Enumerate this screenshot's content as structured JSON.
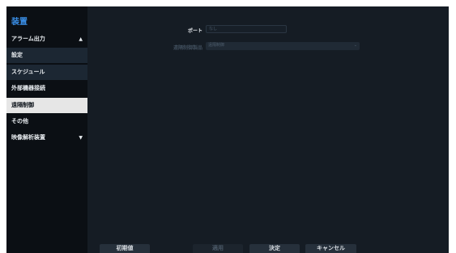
{
  "sidebar": {
    "title": "装置",
    "items": [
      {
        "label": "アラーム出力",
        "arrow": "▲"
      },
      {
        "label": "設定"
      },
      {
        "label": "スケジュール"
      },
      {
        "label": "外部機器接続"
      },
      {
        "label": "遠隔制御"
      },
      {
        "label": "その他"
      },
      {
        "label": "映像解析装置",
        "arrow": "▼"
      }
    ]
  },
  "form": {
    "port_label": "ポート",
    "port_value": "なし",
    "remote_device_label": "遠隔制御製品",
    "remote_device_value": "遠隔制御"
  },
  "footer": {
    "default_button": "初期値",
    "apply_button": "適用",
    "ok_button": "決定",
    "cancel_button": "キャンセル"
  },
  "colors": {
    "accent": "#3a8ee6",
    "background": "#151c24",
    "sidebar": "#0b0f14",
    "active_item": "#e6e6e6"
  }
}
